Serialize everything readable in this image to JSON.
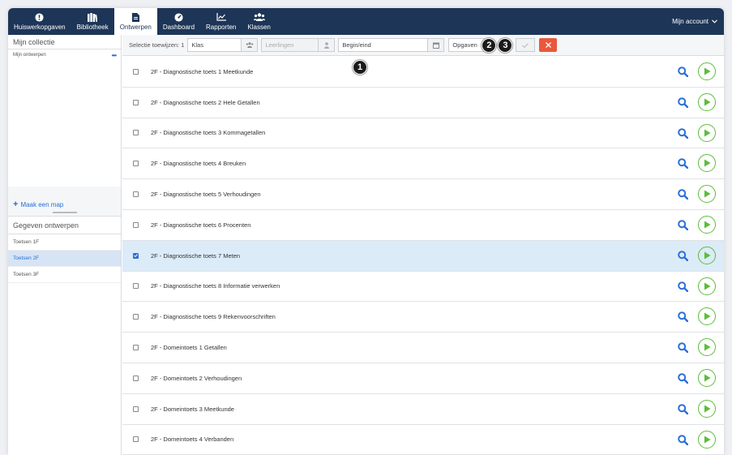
{
  "nav": {
    "items": [
      {
        "label": "Huiswerkopgaven",
        "icon": "alert-circle-icon"
      },
      {
        "label": "Bibliotheek",
        "icon": "library-icon"
      },
      {
        "label": "Ontwerpen",
        "icon": "document-icon"
      },
      {
        "label": "Dashboard",
        "icon": "dashboard-icon"
      },
      {
        "label": "Rapporten",
        "icon": "chart-icon"
      },
      {
        "label": "Klassen",
        "icon": "users-icon"
      }
    ],
    "active": "Ontwerpen",
    "account_label": "Mijn account"
  },
  "sidebar": {
    "collection_title": "Mijn collectie",
    "my_designs": "Mijn ontwerpen",
    "add_folder": "Maak een map",
    "data_title": "Gegeven ontwerpen",
    "items": [
      "Toetsen 1F",
      "Toetsen 2F",
      "Toetsen 3F"
    ],
    "active_item": "Toetsen 2F"
  },
  "toolbar": {
    "selection_label": "Selectie toewijzen: 1",
    "class_value": "Klas",
    "students_placeholder": "Leerlingen",
    "dates_value": "Begin/eind",
    "tasks_value": "Opgaven",
    "badge1": "1",
    "badge2": "2",
    "badge3": "3"
  },
  "list": {
    "rows": [
      {
        "label": "2F - Diagnostische toets 1 Meetkunde",
        "checked": false
      },
      {
        "label": "2F - Diagnostische toets 2 Hele Getallen",
        "checked": false
      },
      {
        "label": "2F - Diagnostische toets 3 Kommagetallen",
        "checked": false
      },
      {
        "label": "2F - Diagnostische toets 4 Breuken",
        "checked": false
      },
      {
        "label": "2F - Diagnostische toets 5 Verhoudingen",
        "checked": false
      },
      {
        "label": "2F - Diagnostische toets 6 Procenten",
        "checked": false
      },
      {
        "label": "2F - Diagnostische toets 7 Meten",
        "checked": true
      },
      {
        "label": "2F - Diagnostische toets 8 Informatie verwerken",
        "checked": false
      },
      {
        "label": "2F - Diagnostische toets 9 Rekenvoorschriften",
        "checked": false
      },
      {
        "label": "2F - Domeintoets 1 Getallen",
        "checked": false
      },
      {
        "label": "2F - Domeintoets 2 Verhoudingen",
        "checked": false
      },
      {
        "label": "2F - Domeintoets 3 Meetkunde",
        "checked": false
      },
      {
        "label": "2F - Domeintoets 4 Verbanden",
        "checked": false
      }
    ]
  },
  "colors": {
    "nav_bg": "#1d3557",
    "accent": "#2a6fd6",
    "play_green": "#5bbd3c",
    "cancel_red": "#e8593b",
    "selected_row": "#dcebf8"
  }
}
